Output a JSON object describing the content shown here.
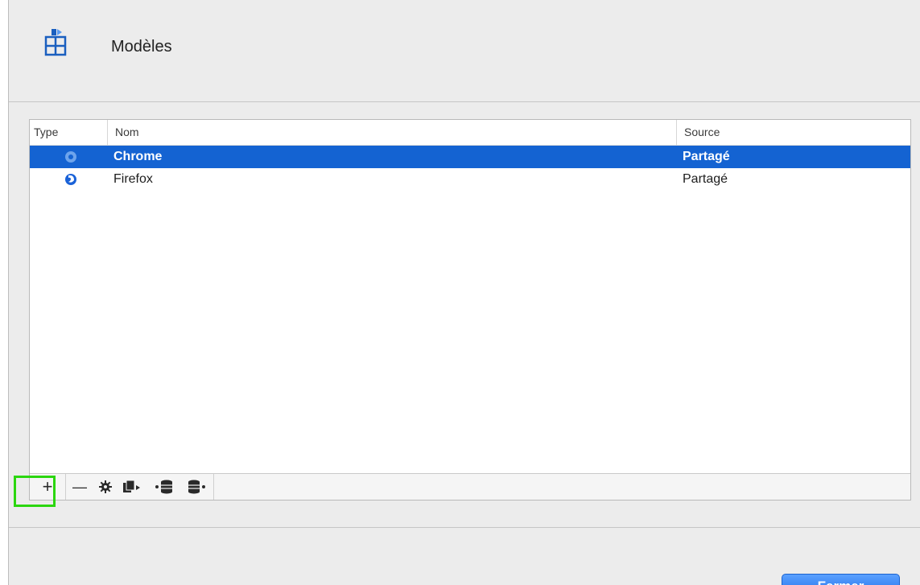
{
  "header": {
    "title": "Modèles",
    "icon": "templates-icon"
  },
  "table": {
    "columns": {
      "type": "Type",
      "name": "Nom",
      "source": "Source"
    },
    "rows": [
      {
        "icon": "chrome-icon",
        "name": "Chrome",
        "source": "Partagé",
        "selected": true
      },
      {
        "icon": "firefox-icon",
        "name": "Firefox",
        "source": "Partagé",
        "selected": false
      }
    ]
  },
  "toolbar": {
    "add": "+",
    "remove": "—",
    "icons": [
      "add-icon",
      "remove-icon",
      "settings-gear-icon",
      "duplicate-icon",
      "import-database-icon",
      "export-database-icon"
    ]
  },
  "footer": {
    "close_label": "Fermer"
  },
  "colors": {
    "selection": "#1463d2",
    "highlight": "#2bd60f",
    "button": "#1f6fe8"
  }
}
